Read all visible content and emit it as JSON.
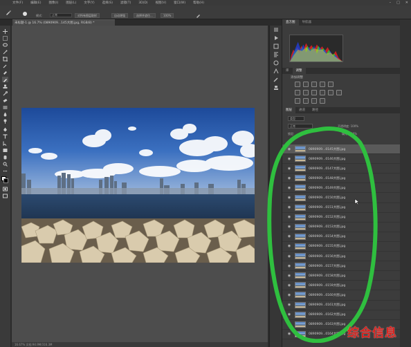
{
  "menubar": {
    "items": [
      "文件(F)",
      "编辑(E)",
      "图像(I)",
      "图层(L)",
      "文字(Y)",
      "选择(S)",
      "滤镜(T)",
      "3D(D)",
      "视图(V)",
      "窗口(W)",
      "帮助(H)"
    ]
  },
  "options": {
    "mode_label": "模式:",
    "mode_value": "正常",
    "opacity_label": "不透明度:",
    "opacity_value": "100%",
    "flow_label": "流量:",
    "flow_value": "100%",
    "btn_sample": "对所有图层取样",
    "btn_auto": "自动增强",
    "btn_refine": "选择并遮住..."
  },
  "document": {
    "tab_title": "未标题-1 @ 16.7% (0890909...145大图.jpg, RGB/8) *",
    "status_text": "16.67%   文档:94.9M/316.3M"
  },
  "right_panel": {
    "tabs_top": [
      "直方图",
      "导航器"
    ],
    "tabs_adj": [
      "库",
      "调整"
    ],
    "adj_title": "添加调整",
    "tabs_layers": [
      "图层",
      "通道",
      "路径"
    ],
    "layers_kind": "类型",
    "layers_mode": "正常",
    "layers_opacity": "不透明度: 100%",
    "layers_lock": "锁定:",
    "layers_fill": "填充: 100%"
  },
  "layers": [
    "0890909...0145大图.jpg",
    "0890909...0146大图.jpg",
    "0890909...0147大图.jpg",
    "0890909...0148大图.jpg",
    "0890909...0149大图.jpg",
    "0890909...0150大图.jpg",
    "0890909...0151大图.jpg",
    "0890909...0152大图.jpg",
    "0890909...0153大图.jpg",
    "0890909...0154大图.jpg",
    "0890909...0155大图.jpg",
    "0890909...0156大图.jpg",
    "0890909...0157大图.jpg",
    "0890909...0158大图.jpg",
    "0890909...0159大图.jpg",
    "0890909...0160大图.jpg",
    "0890909...0161大图.jpg",
    "0890909...0162大图.jpg",
    "0890909...0163大图.jpg",
    "0890909...0164大图.jpg"
  ],
  "watermark": "综合信息",
  "colors": {
    "accent_green": "#2fbf3f",
    "watermark_red": "#d8201c"
  }
}
